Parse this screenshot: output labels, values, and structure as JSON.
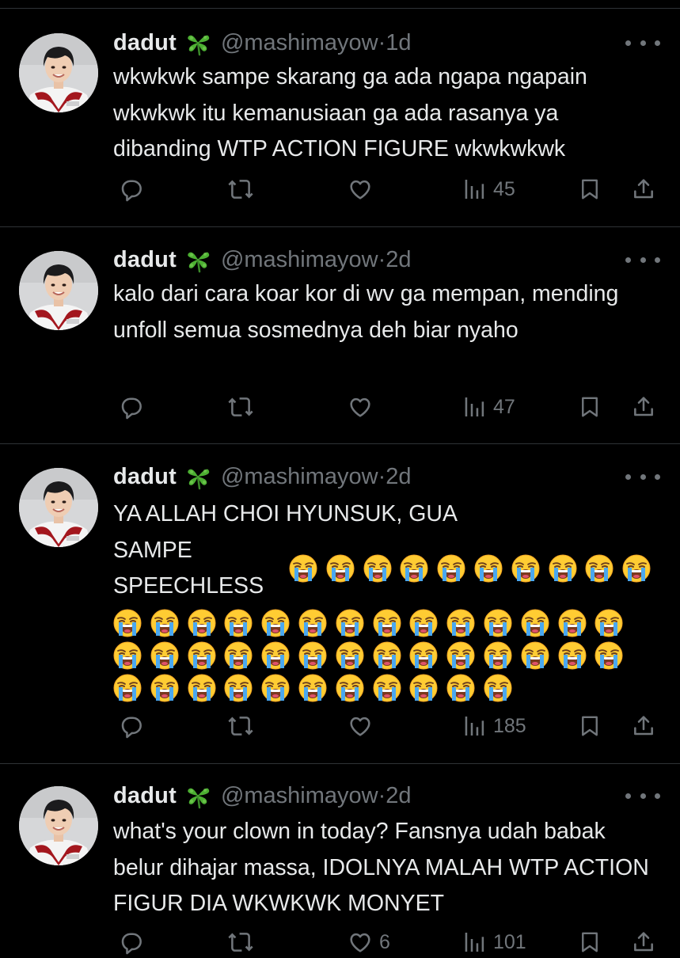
{
  "colors": {
    "background": "#000000",
    "text": "#e7e9ea",
    "muted": "#71767b",
    "divider": "#2f3336"
  },
  "icons": {
    "clover": "four-leaf-clover-emoji",
    "more": "more-dots-icon",
    "reply": "reply-icon",
    "retweet": "retweet-icon",
    "like": "heart-icon",
    "views": "views-bars-icon",
    "bookmark": "bookmark-icon",
    "share": "share-icon",
    "emoji": "loudly-crying-face-emoji"
  },
  "tweets": [
    {
      "user": {
        "name": "dadut",
        "handle": "@mashimayow",
        "time": "1d"
      },
      "text": "wkwkwk sampe skarang ga ada ngapa ngapain wkwkwk itu kemanusiaan ga ada rasanya ya dibanding WTP ACTION FIGURE wkwkwkwk",
      "emoji_count": 0,
      "stats": {
        "replies": "",
        "retweets": "",
        "likes": "",
        "views": "45"
      }
    },
    {
      "user": {
        "name": "dadut",
        "handle": "@mashimayow",
        "time": "2d"
      },
      "text": "kalo dari cara koar kor di wv ga mempan, mending unfoll semua sosmednya deh biar nyaho",
      "emoji_count": 0,
      "stats": {
        "replies": "",
        "retweets": "",
        "likes": "",
        "views": "47"
      }
    },
    {
      "user": {
        "name": "dadut",
        "handle": "@mashimayow",
        "time": "2d"
      },
      "text": "YA ALLAH CHOI HYUNSUK, GUA SAMPE SPEECHLESS",
      "emoji_count": 49,
      "stats": {
        "replies": "",
        "retweets": "",
        "likes": "",
        "views": "185"
      }
    },
    {
      "user": {
        "name": "dadut",
        "handle": "@mashimayow",
        "time": "2d"
      },
      "text": "what's your clown in today? Fansnya udah babak belur dihajar massa, IDOLNYA MALAH WTP ACTION FIGUR DIA WKWKWK MONYET",
      "emoji_count": 0,
      "stats": {
        "replies": "",
        "retweets": "",
        "likes": "6",
        "views": "101"
      }
    }
  ]
}
